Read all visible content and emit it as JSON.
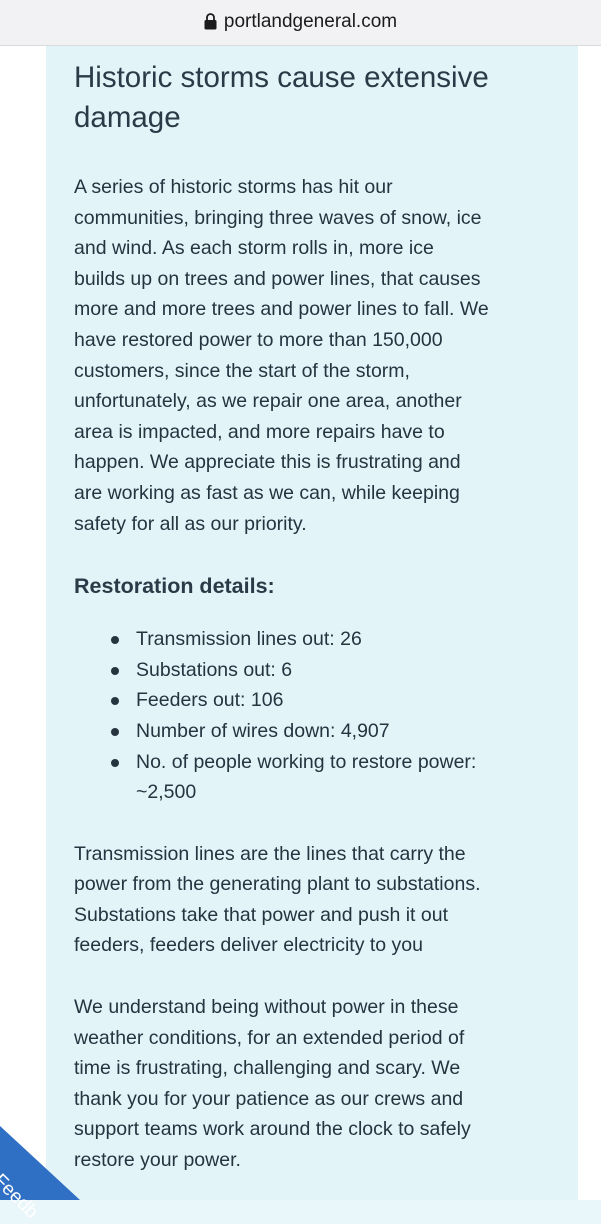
{
  "browser": {
    "url": "portlandgeneral.com"
  },
  "article": {
    "title_line1": "Historic storms cause extensive",
    "title_line2": "damage",
    "intro": [
      "A series of historic storms has hit our",
      "communities, bringing three waves of snow, ice",
      "and wind. As each storm rolls in, more ice",
      "builds up on trees and power lines, that causes",
      "more and more trees and power lines to fall. We",
      "have restored power to more than 150,000",
      "customers, since the start of the storm,",
      "unfortunately, as we repair one area, another",
      "area is impacted, and more repairs have to",
      "happen. We appreciate this is frustrating and",
      "are working as fast as we can, while keeping",
      "safety for all as our priority."
    ],
    "details_heading": "Restoration details:",
    "details": [
      "Transmission lines out: 26",
      "Substations out: 6",
      "Feeders out: 106",
      "Number of wires down: 4,907",
      "No. of people working to restore power:",
      "~2,500"
    ],
    "explanation": [
      "Transmission lines are the lines that carry the",
      "power from the generating plant to substations.",
      "Substations take that power and push it out",
      "feeders, feeders deliver electricity to you"
    ],
    "closing": [
      "We understand being without power in these",
      "weather conditions, for an extended period of",
      "time is frustrating, challenging and scary. We",
      "thank you for your patience as our crews and",
      "support teams work around the clock to safely",
      "restore your power."
    ]
  },
  "feedback": {
    "label": "Feedb"
  },
  "colors": {
    "card_background": "#e3f4f9",
    "text": "#25343f",
    "feedback_tab": "#2f6fc4"
  }
}
